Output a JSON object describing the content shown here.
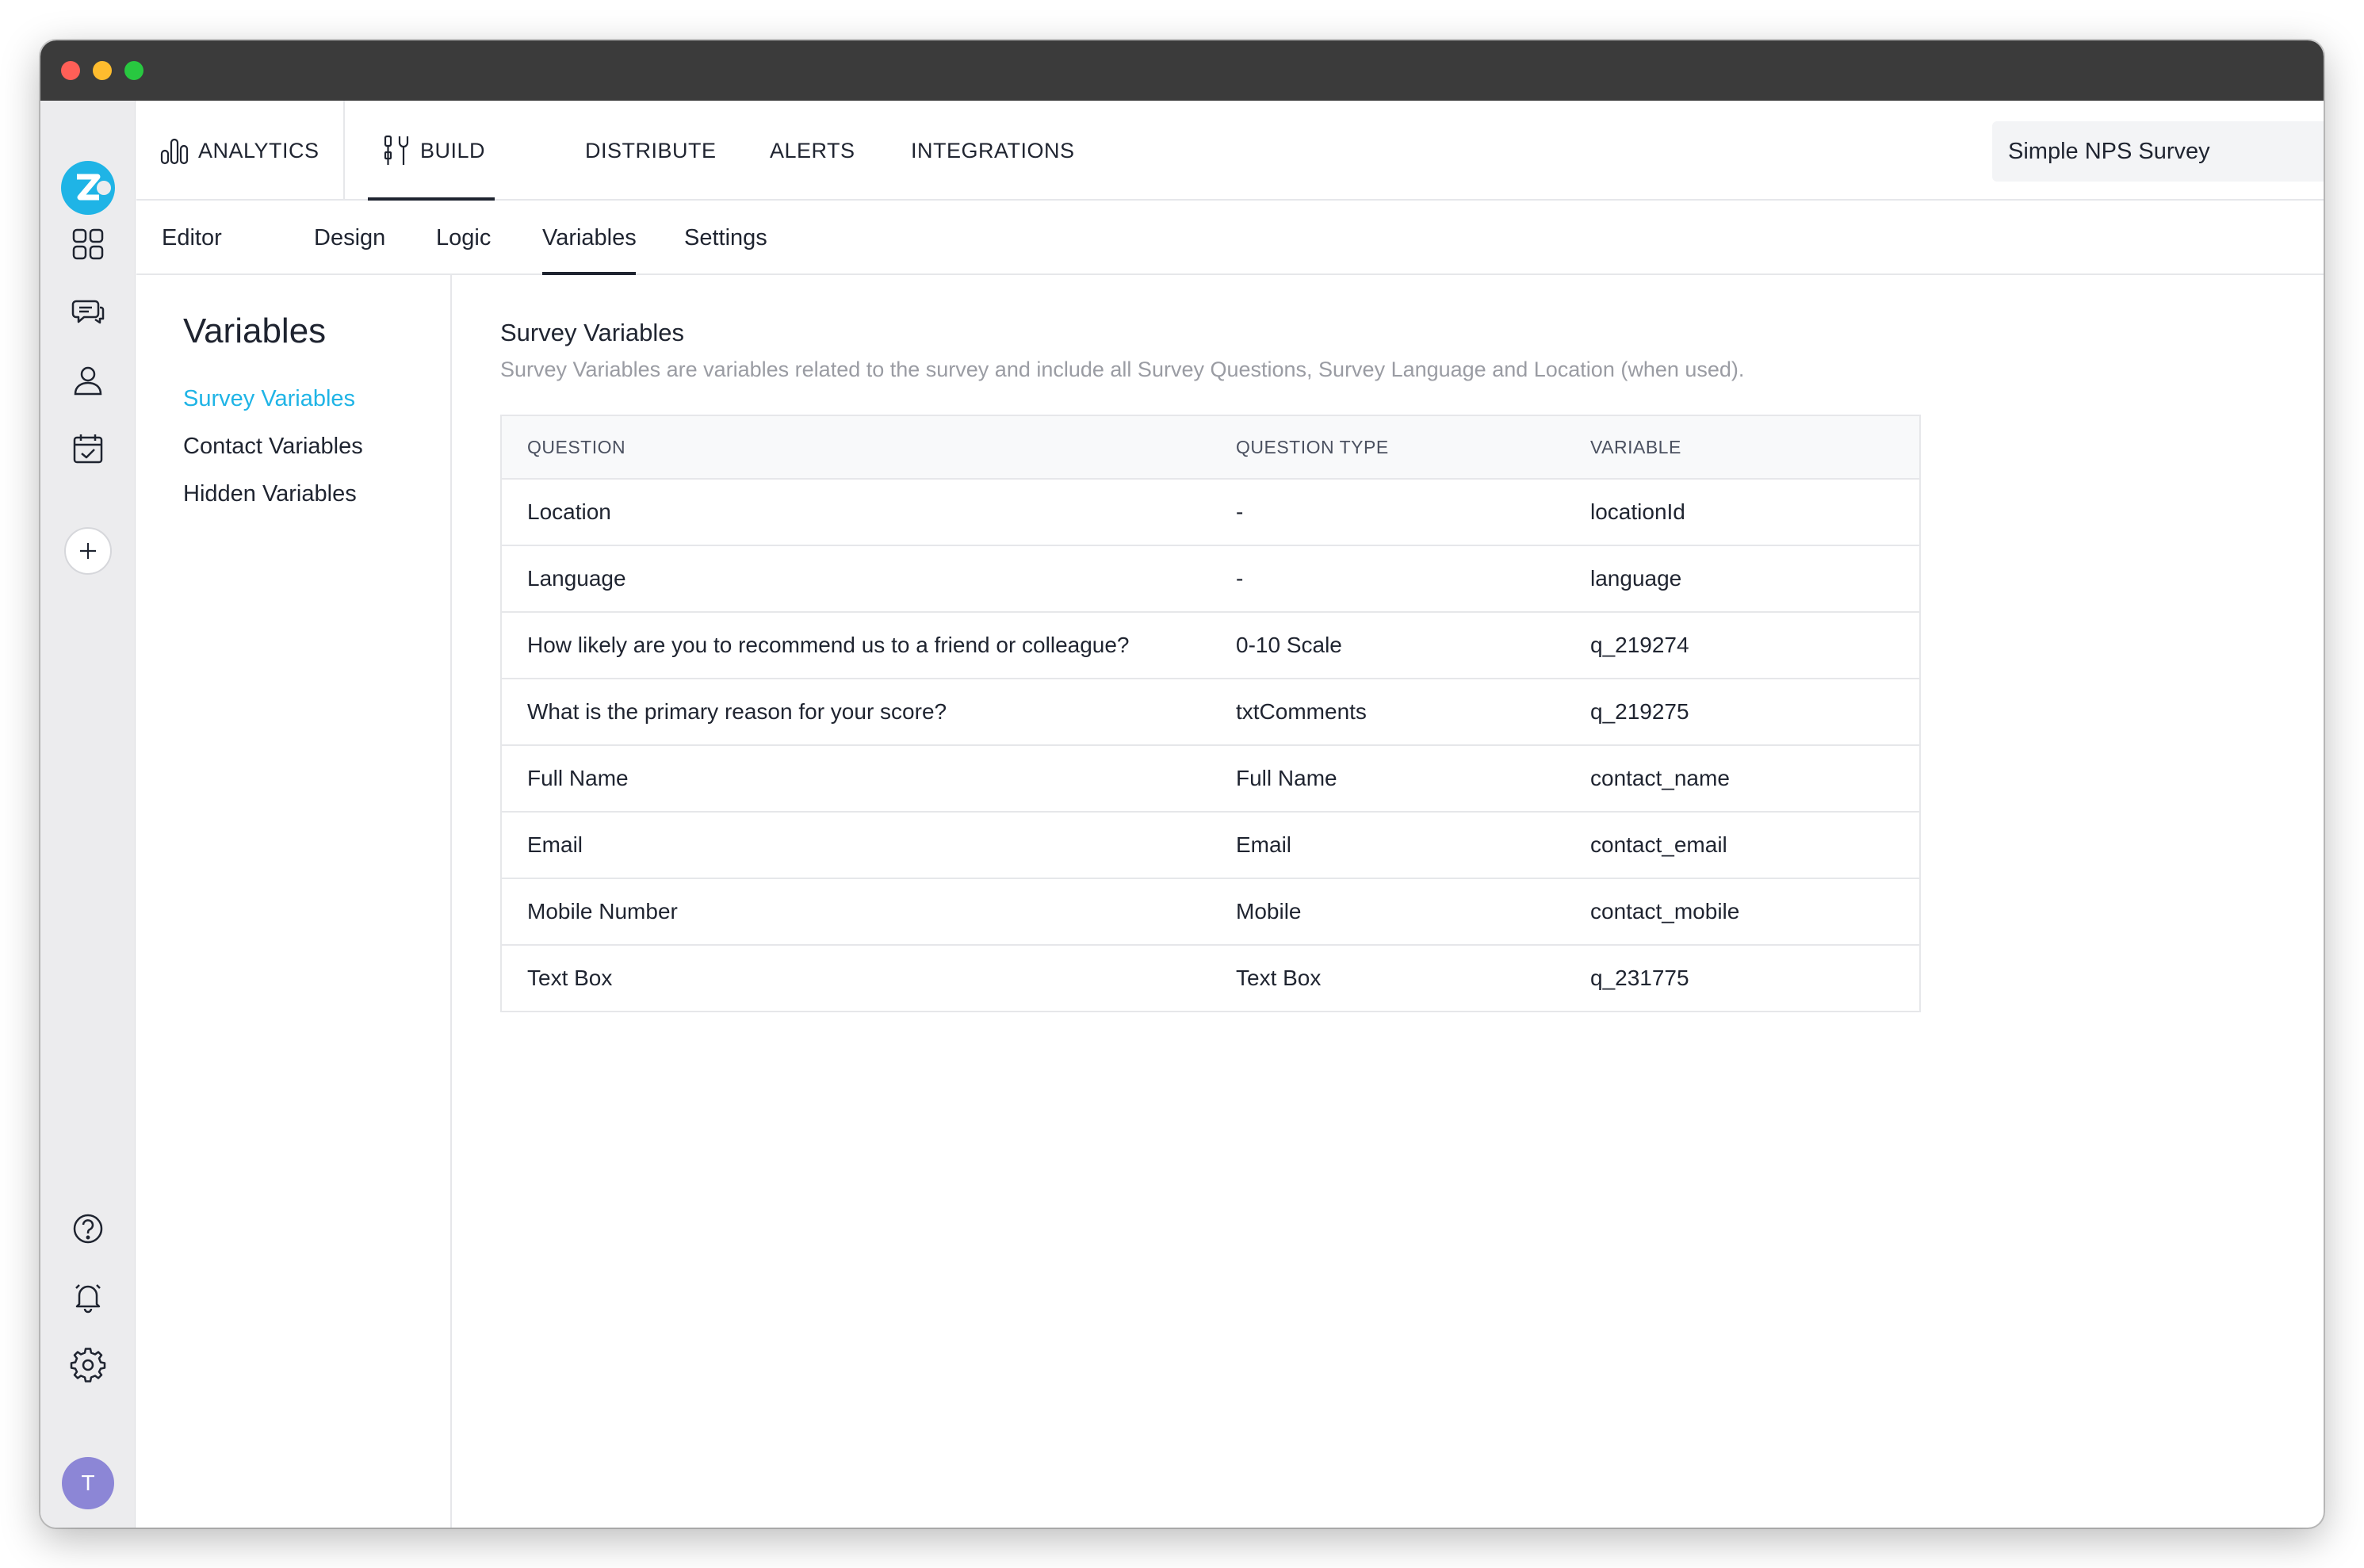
{
  "topnav": {
    "analytics": "ANALYTICS",
    "build": "BUILD",
    "distribute": "DISTRIBUTE",
    "alerts": "ALERTS",
    "integrations": "INTEGRATIONS"
  },
  "survey_selector": {
    "value": "Simple NPS Survey"
  },
  "subnav": {
    "editor": "Editor",
    "design": "Design",
    "logic": "Logic",
    "variables": "Variables",
    "settings": "Settings"
  },
  "sidebar": {
    "title": "Variables",
    "items": [
      "Survey Variables",
      "Contact Variables",
      "Hidden Variables"
    ]
  },
  "section": {
    "title": "Survey Variables",
    "description": "Survey Variables are variables related to the survey and include all Survey Questions, Survey Language and Location (when used)."
  },
  "table": {
    "headers": [
      "QUESTION",
      "QUESTION TYPE",
      "VARIABLE"
    ],
    "rows": [
      [
        "Location",
        "-",
        "locationId"
      ],
      [
        "Language",
        "-",
        "language"
      ],
      [
        "How likely are you to recommend us to a friend or colleague?",
        "0-10 Scale",
        "q_219274"
      ],
      [
        "What is the primary reason for your score?",
        "txtComments",
        "q_219275"
      ],
      [
        "Full Name",
        "Full Name",
        "contact_name"
      ],
      [
        "Email",
        "Email",
        "contact_email"
      ],
      [
        "Mobile Number",
        "Mobile",
        "contact_mobile"
      ],
      [
        "Text Box",
        "Text Box",
        "q_231775"
      ]
    ]
  },
  "user": {
    "avatar_initial": "T"
  },
  "colors": {
    "accent": "#1fb4e6",
    "avatar": "#8c86d6",
    "titlebar": "#3b3b3b"
  },
  "icons": [
    "zonka-logo-icon",
    "dashboard-grid-icon",
    "chat-icon",
    "contact-person-icon",
    "calendar-check-icon",
    "plus-icon",
    "help-icon",
    "bell-icon",
    "gear-icon",
    "chart-icon",
    "build-tools-icon",
    "chevron-down-icon"
  ]
}
